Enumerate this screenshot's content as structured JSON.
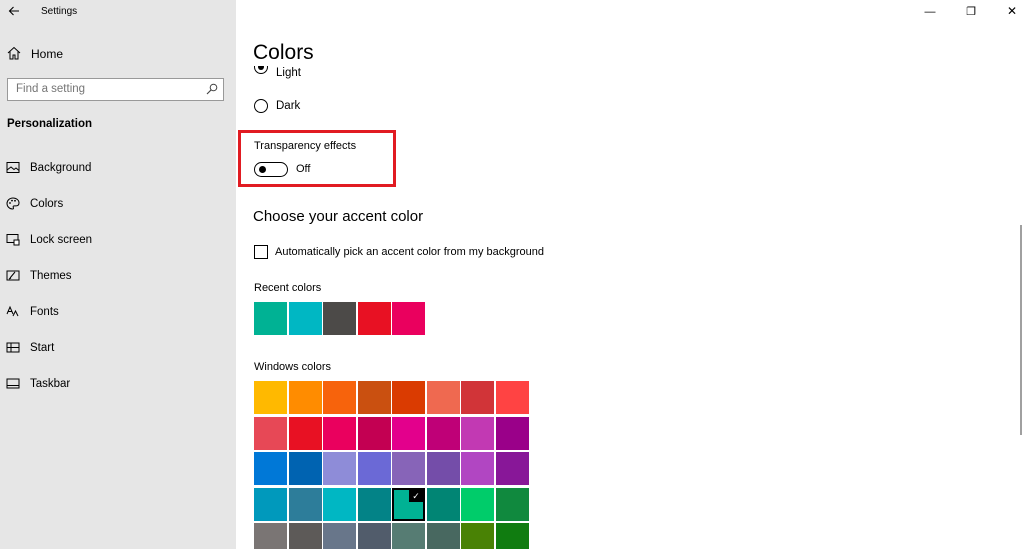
{
  "window": {
    "title": "Settings",
    "back_icon": "arrow-left-icon",
    "minimize_glyph": "—",
    "restore_glyph": "❐",
    "close_glyph": "✕"
  },
  "sidebar": {
    "home_label": "Home",
    "search_placeholder": "Find a setting",
    "section_title": "Personalization",
    "items": [
      {
        "label": "Background",
        "icon": "picture-icon"
      },
      {
        "label": "Colors",
        "icon": "palette-icon"
      },
      {
        "label": "Lock screen",
        "icon": "lock-screen-icon"
      },
      {
        "label": "Themes",
        "icon": "themes-icon"
      },
      {
        "label": "Fonts",
        "icon": "fonts-icon"
      },
      {
        "label": "Start",
        "icon": "start-icon"
      },
      {
        "label": "Taskbar",
        "icon": "taskbar-icon"
      }
    ]
  },
  "main": {
    "page_title": "Colors",
    "mode_options": [
      {
        "label": "Light",
        "checked": true
      },
      {
        "label": "Dark",
        "checked": false
      }
    ],
    "transparency": {
      "title": "Transparency effects",
      "state_label": "Off",
      "on": false
    },
    "accent_heading": "Choose your accent color",
    "auto_pick_label": "Automatically pick an accent color from my background",
    "auto_pick_checked": false,
    "recent_colors_label": "Recent colors",
    "recent_colors": [
      "#00b294",
      "#00b7c3",
      "#4c4a48",
      "#e81123",
      "#ea005e"
    ],
    "windows_colors_label": "Windows colors",
    "windows_colors": [
      [
        "#ffb900",
        "#ff8c00",
        "#f7630c",
        "#ca5010",
        "#da3b01",
        "#ef6950",
        "#d13438",
        "#ff4343"
      ],
      [
        "#e74856",
        "#e81123",
        "#ea005e",
        "#c30052",
        "#e3008c",
        "#bf0077",
        "#c239b3",
        "#9a0089"
      ],
      [
        "#0078d7",
        "#0063b1",
        "#8e8cd8",
        "#6b69d6",
        "#8764b8",
        "#744da9",
        "#b146c2",
        "#881798"
      ],
      [
        "#0099bc",
        "#2d7d9a",
        "#00b7c3",
        "#038387",
        "#00b294",
        "#018574",
        "#00cc6a",
        "#10893e"
      ],
      [
        "#7a7574",
        "#5d5a58",
        "#68768a",
        "#515c6b",
        "#567c73",
        "#486860",
        "#498205",
        "#107c10"
      ]
    ],
    "selected_color": "#00b294",
    "selected_check": "✓"
  }
}
